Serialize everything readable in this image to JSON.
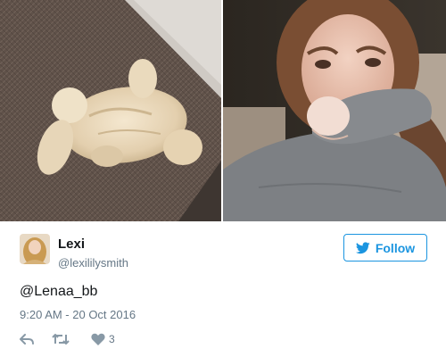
{
  "media": {
    "photos": [
      {
        "icon": "dog-lying-on-rug-photo"
      },
      {
        "icon": "woman-covering-face-photo"
      }
    ]
  },
  "tweet": {
    "author": {
      "display_name": "Lexi",
      "handle": "@lexililysmith",
      "avatar_icon": "user-avatar"
    },
    "follow_label": "Follow",
    "text": "@Lenaa_bb",
    "timestamp": "9:20 AM - 20 Oct 2016",
    "actions": {
      "reply_icon": "reply-icon",
      "retweet_icon": "retweet-icon",
      "like_icon": "heart-icon",
      "like_count": "3"
    }
  },
  "colors": {
    "accent": "#1b95e0",
    "secondary_text": "#657786",
    "primary_text": "#14171a",
    "action_icon": "#8899a6"
  }
}
